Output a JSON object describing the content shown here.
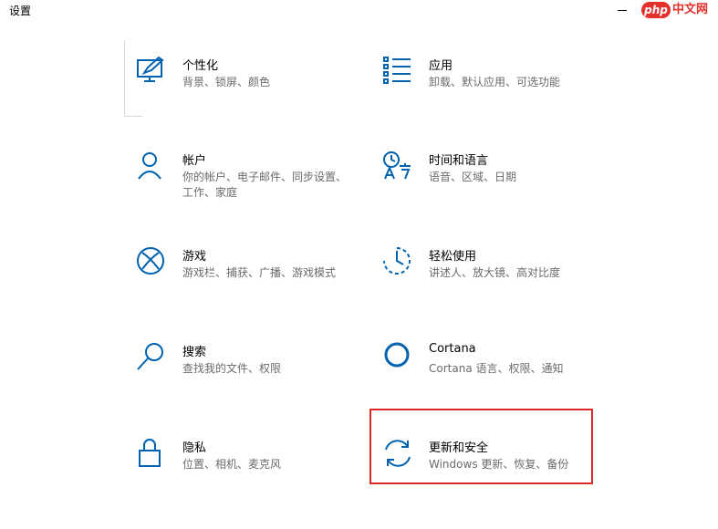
{
  "window": {
    "title": "设置"
  },
  "watermark": {
    "badge": "php",
    "text": "中文网"
  },
  "colors": {
    "accent": "#0063b1",
    "highlight": "#d82828",
    "desc": "#6b6b6b"
  },
  "tiles": [
    {
      "title": "个性化",
      "desc": "背景、锁屏、颜色",
      "icon": "personalization-icon"
    },
    {
      "title": "应用",
      "desc": "卸载、默认应用、可选功能",
      "icon": "apps-icon"
    },
    {
      "title": "帐户",
      "desc": "你的帐户、电子邮件、同步设置、工作、家庭",
      "icon": "account-icon"
    },
    {
      "title": "时间和语言",
      "desc": "语音、区域、日期",
      "icon": "time-language-icon"
    },
    {
      "title": "游戏",
      "desc": "游戏栏、捕获、广播、游戏模式",
      "icon": "xbox-icon"
    },
    {
      "title": "轻松使用",
      "desc": "讲述人、放大镜、高对比度",
      "icon": "ease-of-access-icon"
    },
    {
      "title": "搜索",
      "desc": "查找我的文件、权限",
      "icon": "search-icon"
    },
    {
      "title": "Cortana",
      "desc": "Cortana 语言、权限、通知",
      "icon": "cortana-icon"
    },
    {
      "title": "隐私",
      "desc": "位置、相机、麦克风",
      "icon": "lock-icon"
    },
    {
      "title": "更新和安全",
      "desc": "Windows 更新、恢复、备份",
      "icon": "update-icon"
    }
  ]
}
